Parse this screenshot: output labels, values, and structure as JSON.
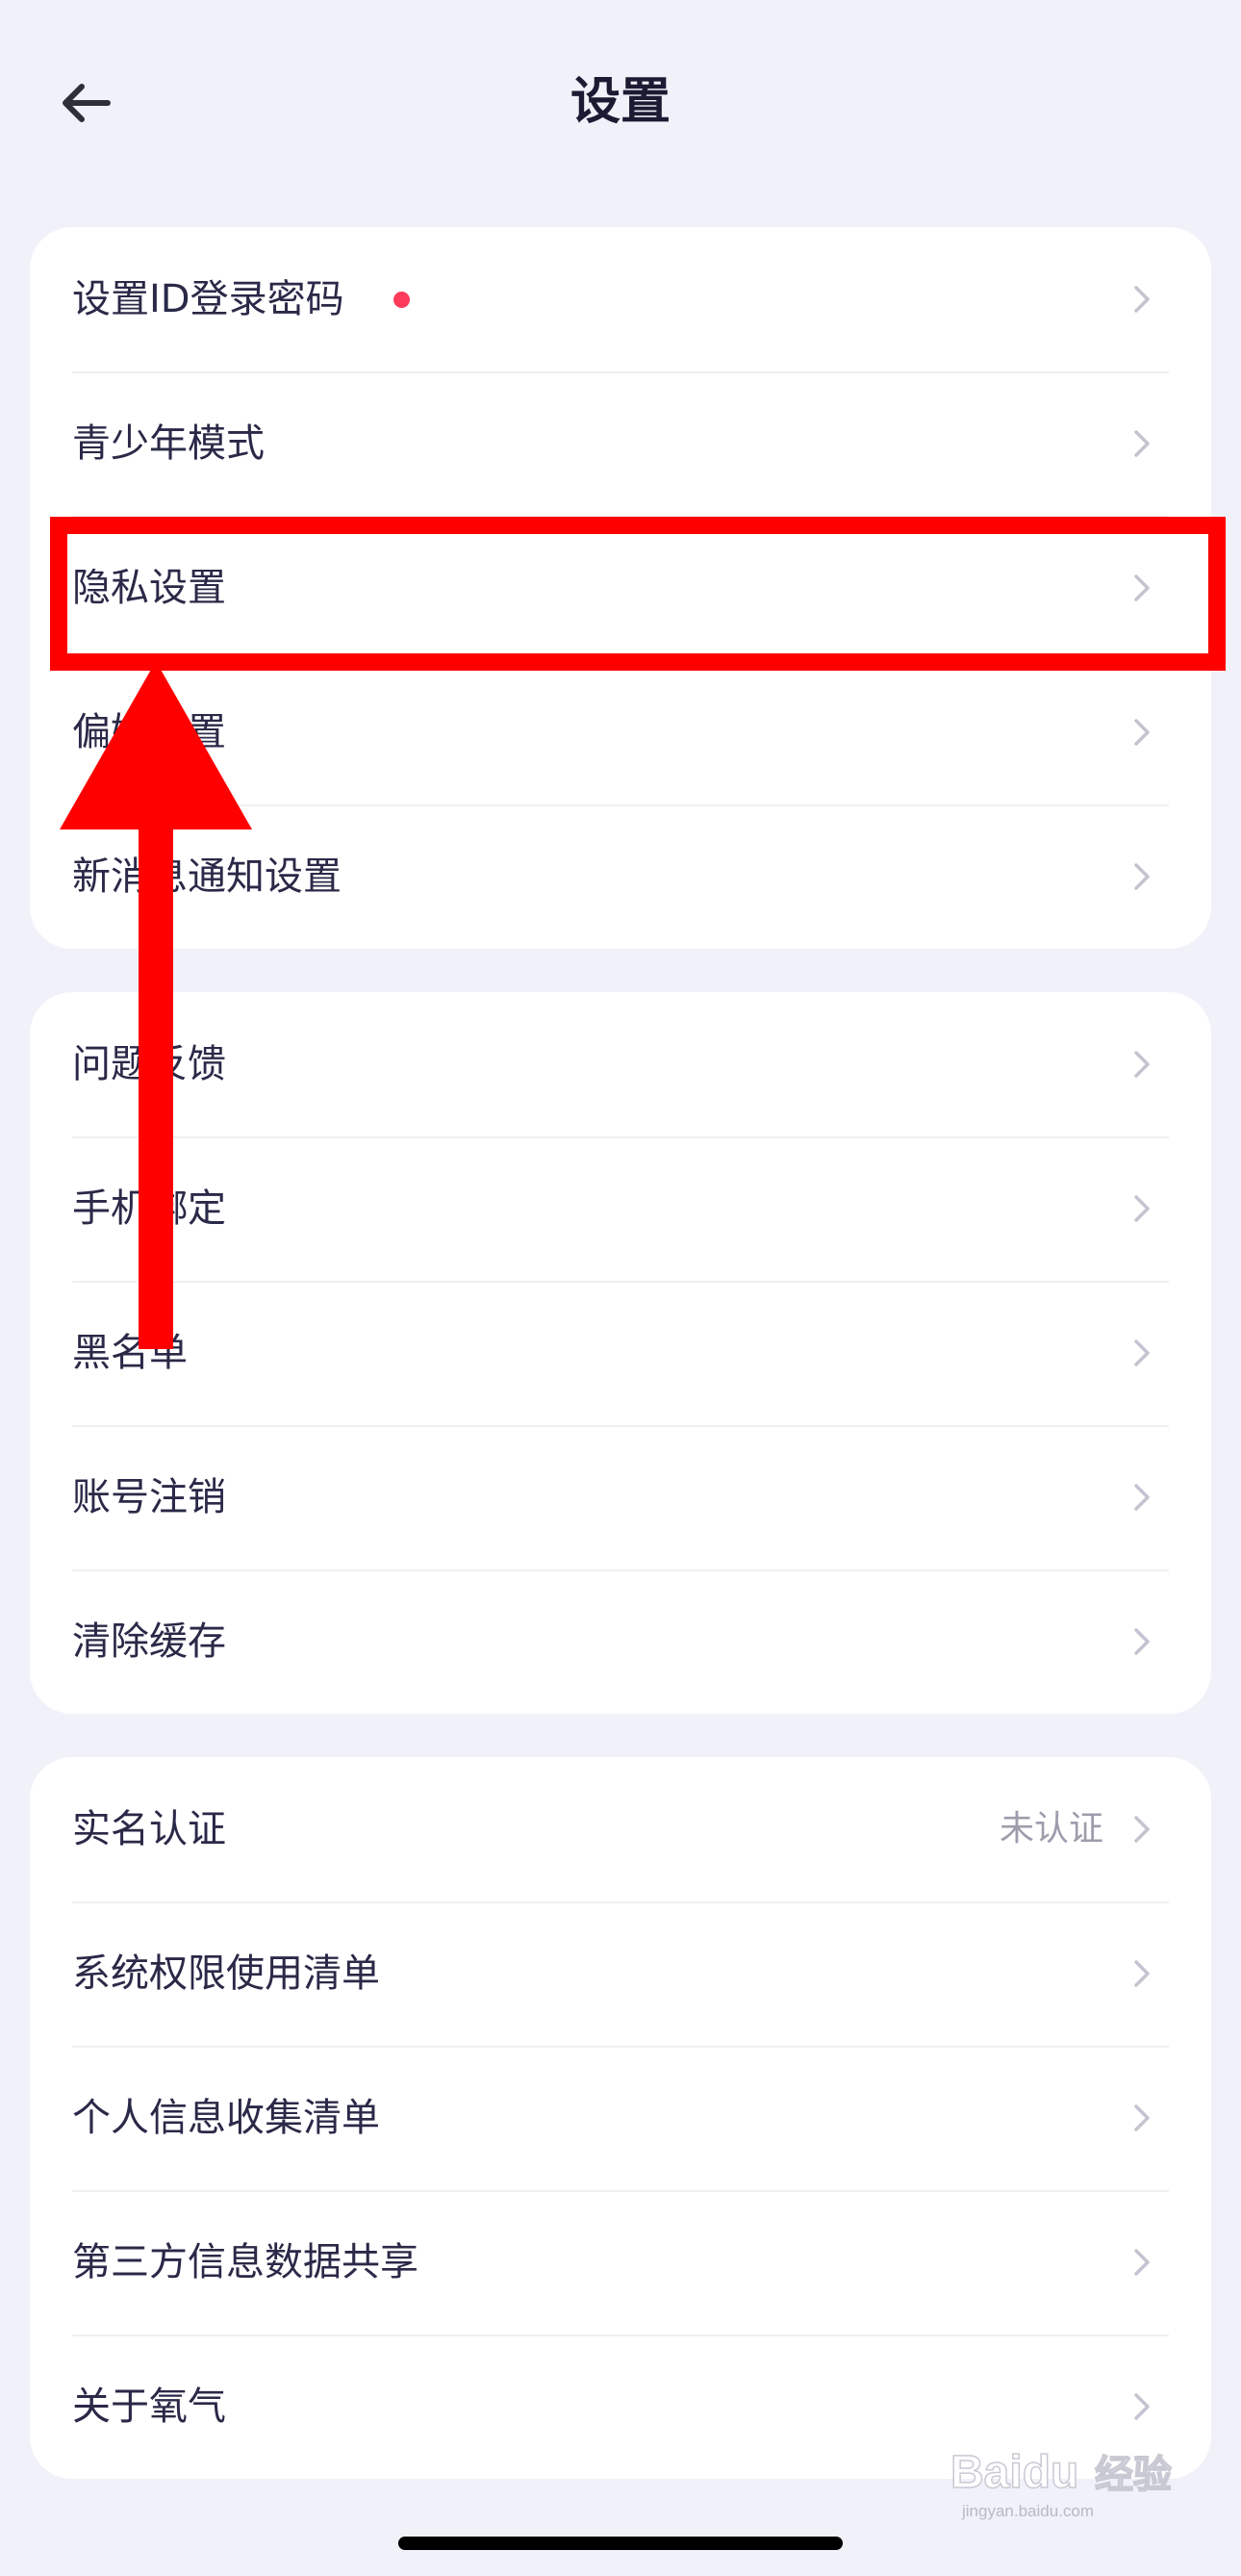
{
  "header": {
    "title": "设置"
  },
  "card1": [
    {
      "label": "设置ID登录密码",
      "badge": true
    },
    {
      "label": "青少年模式"
    },
    {
      "label": "隐私设置"
    },
    {
      "label": "偏好设置"
    },
    {
      "label": "新消息通知设置"
    }
  ],
  "card2": [
    {
      "label": "问题反馈"
    },
    {
      "label": "手机绑定"
    },
    {
      "label": "黑名单"
    },
    {
      "label": "账号注销"
    },
    {
      "label": "清除缓存"
    }
  ],
  "card3": [
    {
      "label": "实名认证",
      "value": "未认证"
    },
    {
      "label": "系统权限使用清单"
    },
    {
      "label": "个人信息收集清单"
    },
    {
      "label": "第三方信息数据共享"
    },
    {
      "label": "关于氧气"
    }
  ],
  "watermark": {
    "brand": "Baidu",
    "suffix": "经验",
    "url": "jingyan.baidu.com"
  },
  "colors": {
    "background": "#f1f1f9",
    "card": "#ffffff",
    "text": "#2a2948",
    "badge": "#ff3b5c",
    "annotation": "#ff0000"
  },
  "icons": {
    "back": "arrow-left-icon",
    "row": "chevron-right-icon"
  }
}
